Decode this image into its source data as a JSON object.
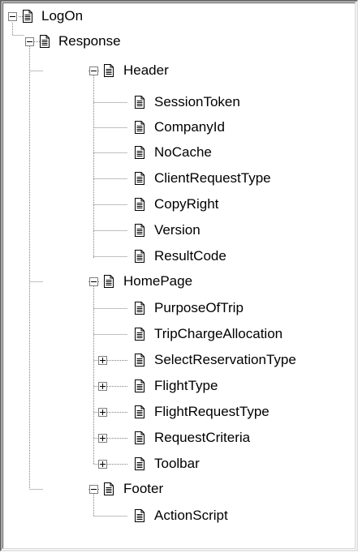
{
  "tree": {
    "nodes": [
      {
        "label": "LogOn",
        "expander": "minus"
      },
      {
        "label": "Response",
        "expander": "minus"
      },
      {
        "label": "Header",
        "expander": "minus"
      },
      {
        "label": "SessionToken",
        "expander": "none"
      },
      {
        "label": "CompanyId",
        "expander": "none"
      },
      {
        "label": "NoCache",
        "expander": "none"
      },
      {
        "label": "ClientRequestType",
        "expander": "none"
      },
      {
        "label": "CopyRight",
        "expander": "none"
      },
      {
        "label": "Version",
        "expander": "none"
      },
      {
        "label": "ResultCode",
        "expander": "none"
      },
      {
        "label": "HomePage",
        "expander": "minus"
      },
      {
        "label": "PurposeOfTrip",
        "expander": "none"
      },
      {
        "label": "TripChargeAllocation",
        "expander": "none"
      },
      {
        "label": "SelectReservationType",
        "expander": "plus"
      },
      {
        "label": "FlightType",
        "expander": "plus"
      },
      {
        "label": "FlightRequestType",
        "expander": "plus"
      },
      {
        "label": "RequestCriteria",
        "expander": "plus"
      },
      {
        "label": "Toolbar",
        "expander": "plus"
      },
      {
        "label": "Footer",
        "expander": "minus"
      },
      {
        "label": "ActionScript",
        "expander": "none"
      }
    ],
    "icon": "document-icon"
  }
}
